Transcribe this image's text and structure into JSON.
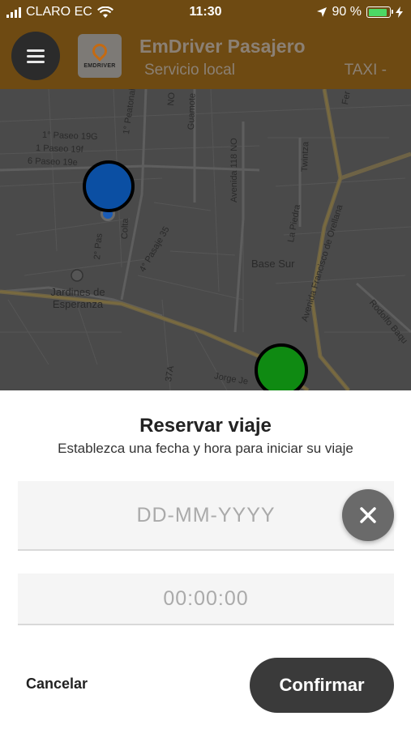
{
  "status_bar": {
    "carrier": "CLARO EC",
    "time": "11:30",
    "battery_percent": "90 %",
    "battery_level": 0.9,
    "icons": [
      "signal-icon",
      "wifi-icon",
      "location-arrow-icon",
      "battery-icon",
      "charging-icon"
    ]
  },
  "header": {
    "menu_icon": "hamburger-menu-icon",
    "logo_text": "EMDRIVER",
    "title": "EmDriver Pasajero",
    "subtitle": "Servicio local",
    "service": "TAXI -"
  },
  "map": {
    "labels": {
      "paseo_19g": "1° Paseo 19G",
      "paseo_19f": "1 Paseo 19f",
      "paseo_19e": "6 Paseo 19e",
      "peatonal_35no": "1° Peatonal 35 NO",
      "guamote": "Guamote",
      "avenida_118": "Avenida 118 NO",
      "twintza": "Twintza",
      "pasaje_35": "4° Pasaje 35",
      "colta": "Colta",
      "pas": "2° Pas",
      "base_sur": "Base Sur",
      "la_piedra": "La Piedra",
      "orellana": "Avenida Francisco de Orellana",
      "jardines": "Jardines de Esperanza",
      "rodolfo": "Rodolfo Baqu",
      "jorge": "Jorge Je",
      "no": "NO",
      "37a": "37A",
      "fer": "Fer"
    },
    "origin_color": "#0b4fa3",
    "destination_color": "#0f8a12"
  },
  "sheet": {
    "title": "Reservar viaje",
    "subtitle": "Establezca una fecha y hora para iniciar su viaje",
    "date_placeholder": "DD-MM-YYYY",
    "time_placeholder": "00:00:00",
    "clear_icon": "close-icon",
    "cancel_label": "Cancelar",
    "confirm_label": "Confirmar"
  }
}
